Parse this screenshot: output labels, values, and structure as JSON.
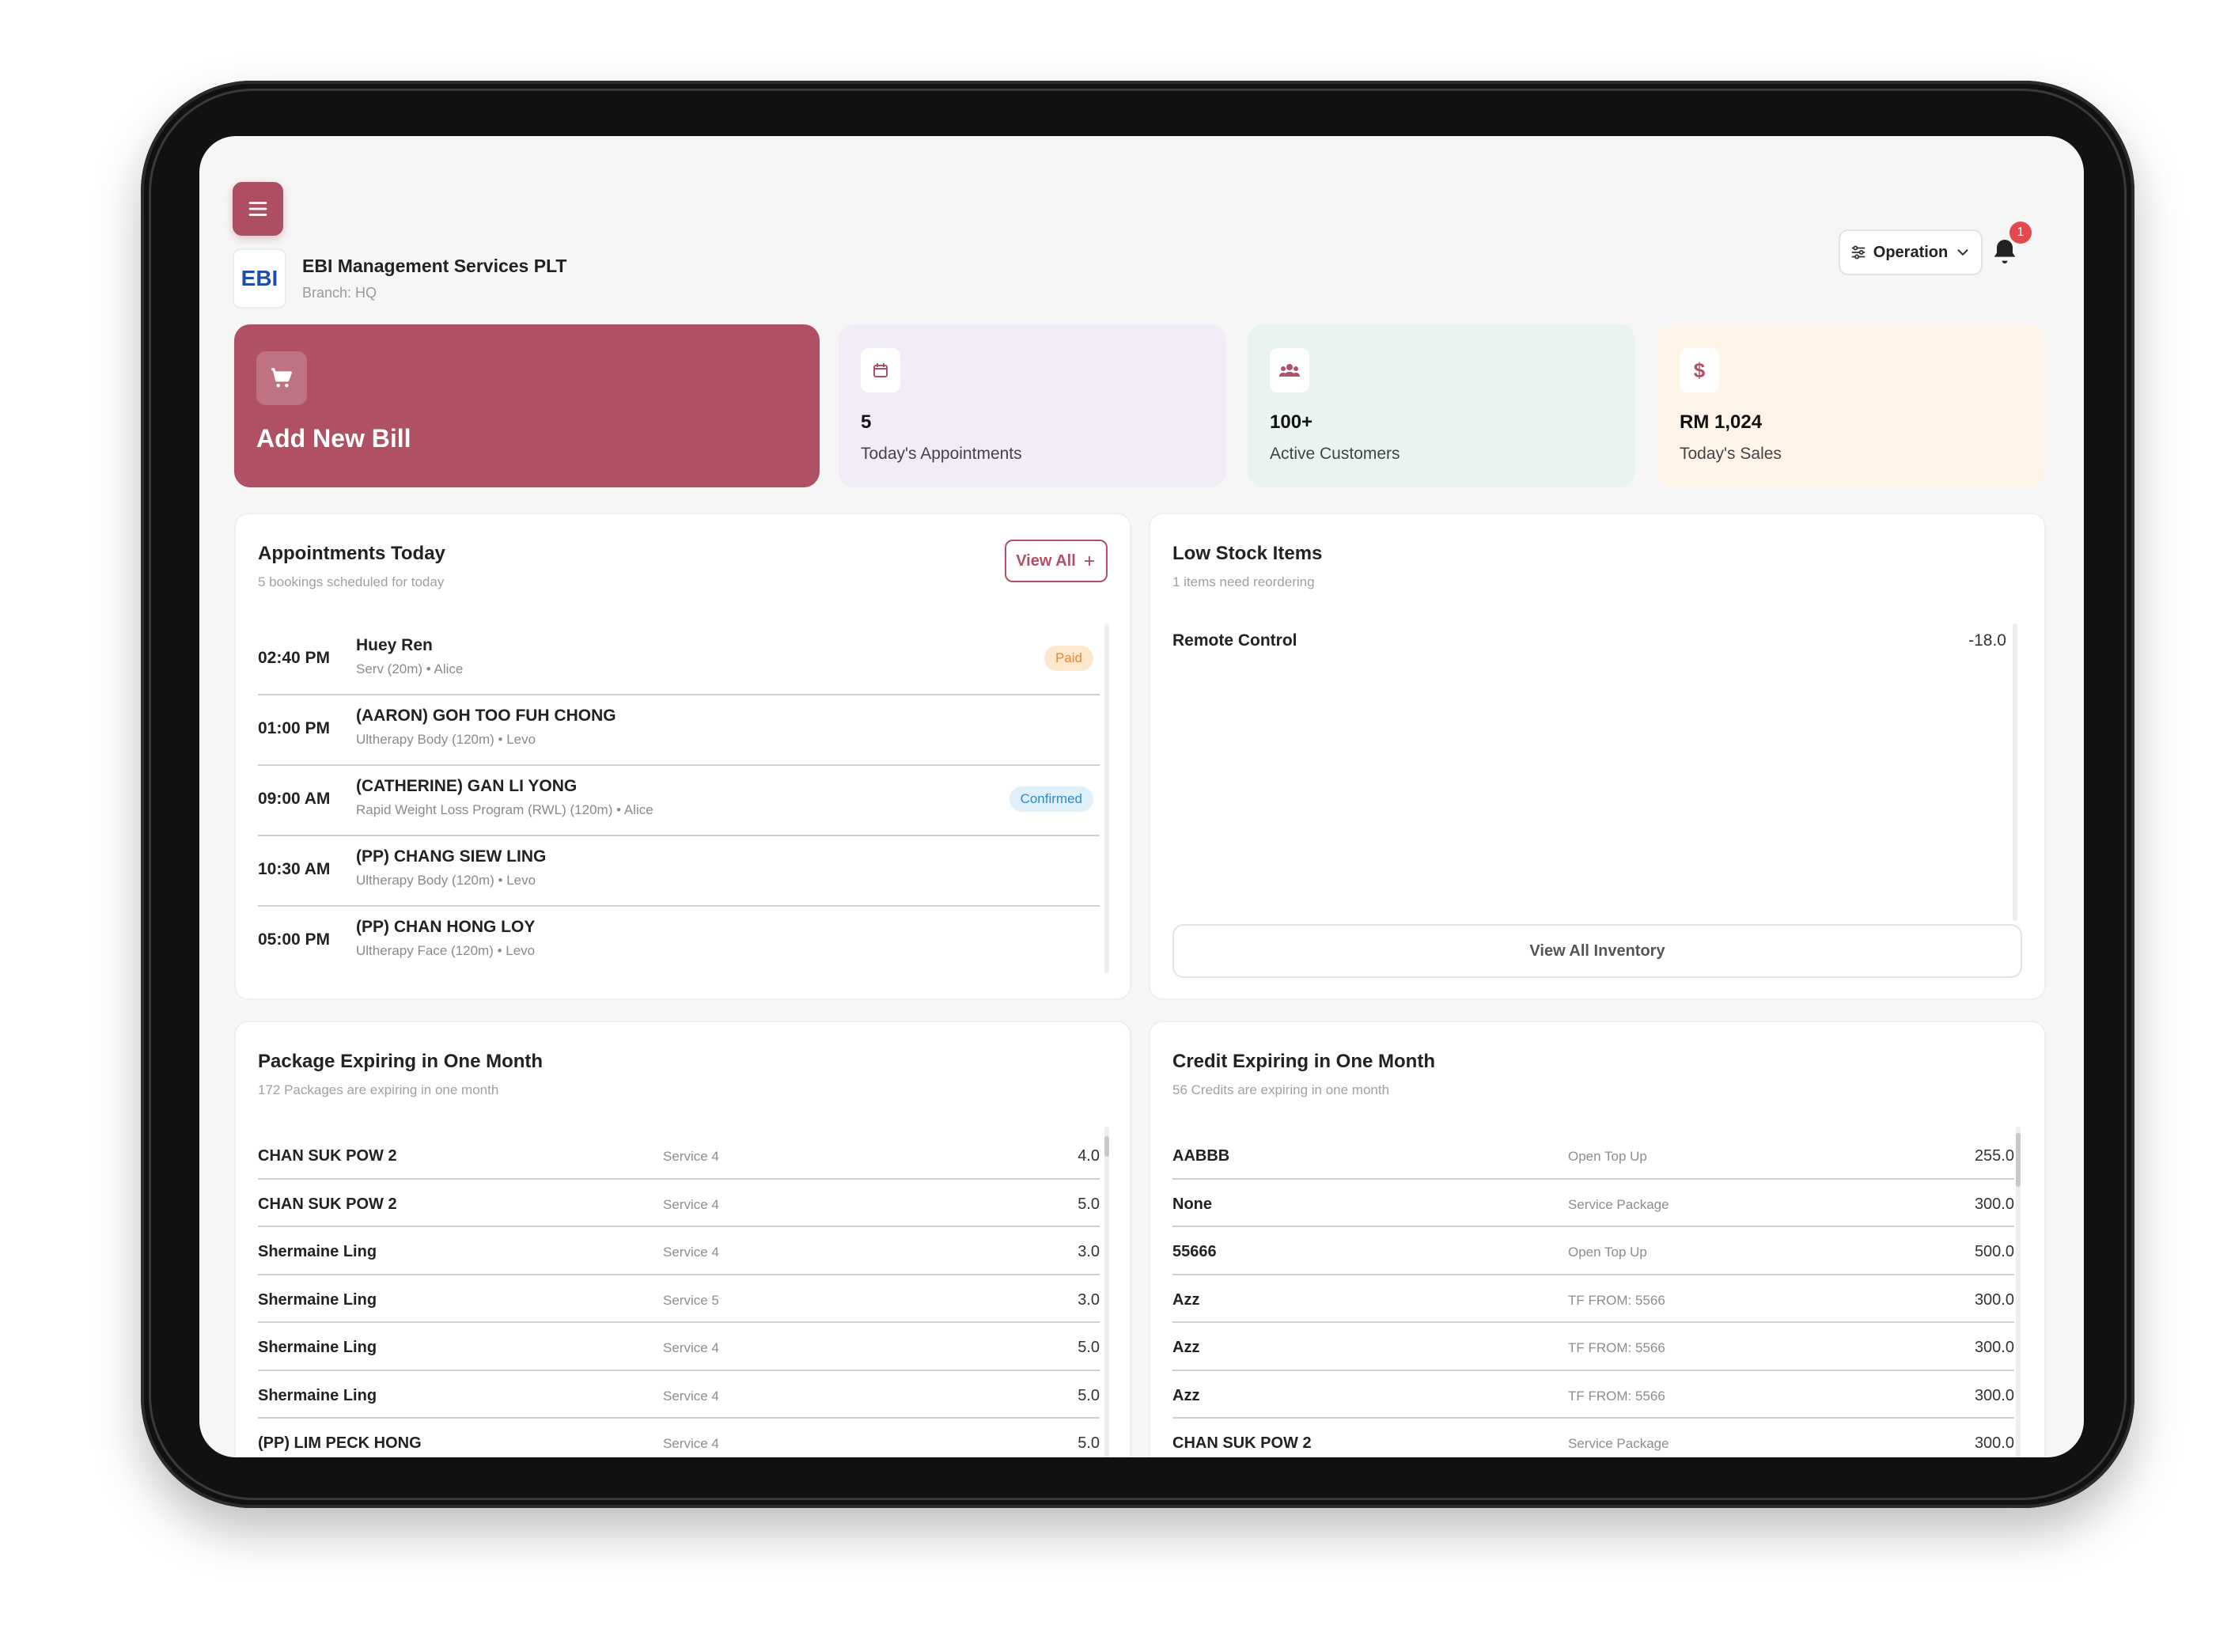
{
  "header": {
    "company": "EBI Management Services PLT",
    "branch": "Branch: HQ",
    "logo_text": "EBI",
    "operation_label": "Operation",
    "notification_count": "1"
  },
  "quick": {
    "add_bill": "Add New Bill",
    "appointments": {
      "value": "5",
      "caption": "Today's Appointments"
    },
    "customers": {
      "value": "100+",
      "caption": "Active Customers"
    },
    "sales": {
      "value": "RM 1,024",
      "caption": "Today's Sales",
      "icon": "$"
    }
  },
  "appointments": {
    "title": "Appointments Today",
    "subtitle": "5 bookings scheduled for today",
    "view_all": "View All",
    "items": [
      {
        "time": "02:40 PM",
        "name": "Huey Ren",
        "detail": "Serv (20m) • Alice",
        "status": "Paid"
      },
      {
        "time": "01:00 PM",
        "name": "(AARON) GOH TOO FUH CHONG",
        "detail": "Ultherapy Body (120m) • Levo",
        "status": ""
      },
      {
        "time": "09:00 AM",
        "name": "(CATHERINE) GAN LI YONG",
        "detail": "Rapid Weight Loss Program (RWL) (120m) • Alice",
        "status": "Confirmed"
      },
      {
        "time": "10:30 AM",
        "name": "(PP) CHANG SIEW LING",
        "detail": "Ultherapy Body (120m) • Levo",
        "status": ""
      },
      {
        "time": "05:00 PM",
        "name": "(PP) CHAN HONG LOY",
        "detail": "Ultherapy Face (120m) • Levo",
        "status": ""
      }
    ]
  },
  "low_stock": {
    "title": "Low Stock Items",
    "subtitle": "1 items need reordering",
    "items": [
      {
        "name": "Remote Control",
        "qty": "-18.0"
      }
    ],
    "view_inventory": "View All Inventory"
  },
  "packages": {
    "title": "Package Expiring in One Month",
    "subtitle": "172 Packages are expiring in one month",
    "rows": [
      {
        "name": "CHAN SUK POW 2",
        "service": "Service 4",
        "value": "4.0"
      },
      {
        "name": "CHAN SUK POW 2",
        "service": "Service 4",
        "value": "5.0"
      },
      {
        "name": "Shermaine Ling",
        "service": "Service 4",
        "value": "3.0"
      },
      {
        "name": "Shermaine Ling",
        "service": "Service 5",
        "value": "3.0"
      },
      {
        "name": "Shermaine Ling",
        "service": "Service 4",
        "value": "5.0"
      },
      {
        "name": "Shermaine Ling",
        "service": "Service 4",
        "value": "5.0"
      },
      {
        "name": "(PP) LIM PECK HONG",
        "service": "Service 4",
        "value": "5.0"
      }
    ]
  },
  "credits": {
    "title": "Credit Expiring in One Month",
    "subtitle": "56 Credits are expiring in one month",
    "rows": [
      {
        "name": "AABBB",
        "type": "Open Top Up",
        "value": "255.0"
      },
      {
        "name": "None",
        "type": "Service Package",
        "value": "300.0"
      },
      {
        "name": "55666",
        "type": "Open Top Up",
        "value": "500.0"
      },
      {
        "name": "Azz",
        "type": "TF FROM: 5566",
        "value": "300.0"
      },
      {
        "name": "Azz",
        "type": "TF FROM: 5566",
        "value": "300.0"
      },
      {
        "name": "Azz",
        "type": "TF FROM: 5566",
        "value": "300.0"
      },
      {
        "name": "CHAN SUK POW 2",
        "type": "Service Package",
        "value": "300.0"
      }
    ]
  },
  "colors": {
    "accent": "#b05063",
    "appt_card": "#f1ecf8",
    "cust_card": "#e9f4ef",
    "sales_card": "#fdf3e7"
  }
}
